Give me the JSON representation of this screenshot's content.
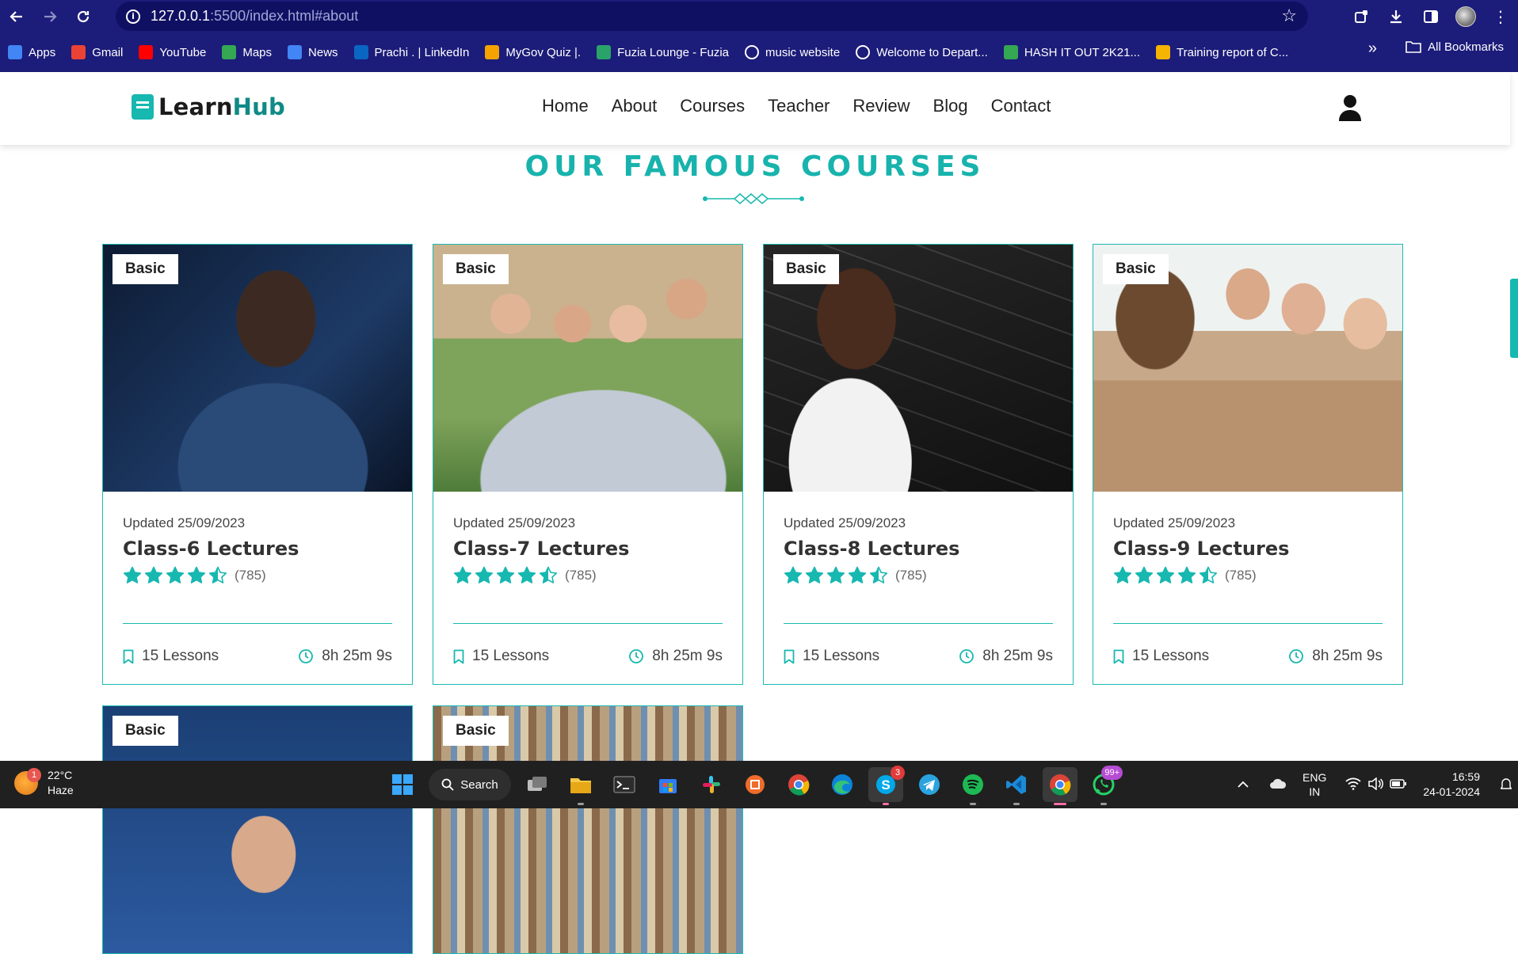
{
  "browser": {
    "url_host": "127.0.0.1",
    "url_rest": ":5500/index.html#about",
    "bookmarks": [
      {
        "label": "Apps",
        "color": "#4285f4"
      },
      {
        "label": "Gmail",
        "color": "#ea4335"
      },
      {
        "label": "YouTube",
        "color": "#ff0000"
      },
      {
        "label": "Maps",
        "color": "#34a853"
      },
      {
        "label": "News",
        "color": "#4285f4"
      },
      {
        "label": "Prachi . | LinkedIn",
        "color": "#0a66c2"
      },
      {
        "label": "MyGov Quiz |.",
        "color": "#f4a300"
      },
      {
        "label": "Fuzia Lounge - Fuzia",
        "color": "#2aa36a"
      },
      {
        "label": "music website",
        "color": "#ffffff"
      },
      {
        "label": "Welcome to Depart...",
        "color": "#ffffff"
      },
      {
        "label": "HASH IT OUT 2K21...",
        "color": "#34a853"
      },
      {
        "label": "Training report of C...",
        "color": "#f4b400"
      }
    ],
    "all_bookmarks_label": "All Bookmarks"
  },
  "site": {
    "logo_main": "Learn",
    "logo_accent": "Hub",
    "nav": [
      "Home",
      "About",
      "Courses",
      "Teacher",
      "Review",
      "Blog",
      "Contact"
    ],
    "brand_color": "#17b8b0"
  },
  "section": {
    "title": "OUR FAMOUS COURSES"
  },
  "courses": [
    {
      "badge": "Basic",
      "updated": "Updated 25/09/2023",
      "title": "Class-6 Lectures",
      "rating": 4.5,
      "rating_count": "(785)",
      "lessons": "15 Lessons",
      "duration": "8h 25m 9s"
    },
    {
      "badge": "Basic",
      "updated": "Updated 25/09/2023",
      "title": "Class-7 Lectures",
      "rating": 4.5,
      "rating_count": "(785)",
      "lessons": "15 Lessons",
      "duration": "8h 25m 9s"
    },
    {
      "badge": "Basic",
      "updated": "Updated 25/09/2023",
      "title": "Class-8 Lectures",
      "rating": 4.5,
      "rating_count": "(785)",
      "lessons": "15 Lessons",
      "duration": "8h 25m 9s"
    },
    {
      "badge": "Basic",
      "updated": "Updated 25/09/2023",
      "title": "Class-9 Lectures",
      "rating": 4.5,
      "rating_count": "(785)",
      "lessons": "15 Lessons",
      "duration": "8h 25m 9s"
    },
    {
      "badge": "Basic"
    },
    {
      "badge": "Basic"
    }
  ],
  "taskbar": {
    "weather_temp": "22°C",
    "weather_desc": "Haze",
    "weather_badge": "1",
    "search_label": "Search",
    "skype_badge": "3",
    "whatsapp_badge": "99+",
    "lang_line1": "ENG",
    "lang_line2": "IN",
    "time": "16:59",
    "date": "24-01-2024"
  }
}
